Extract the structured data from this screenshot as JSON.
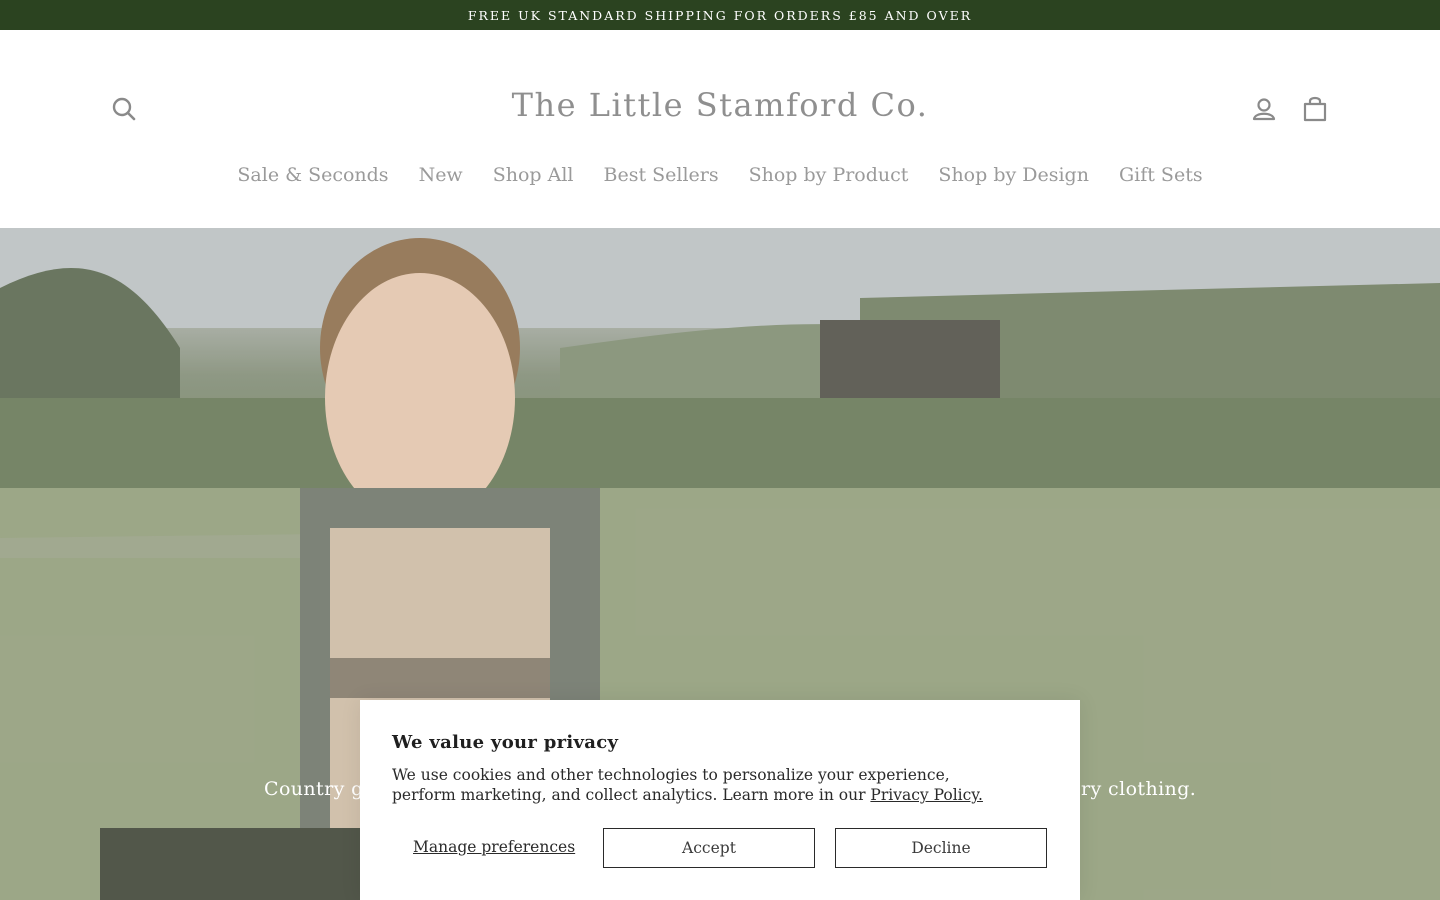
{
  "announcement": {
    "text": "FREE UK STANDARD SHIPPING FOR ORDERS £85 AND OVER"
  },
  "header": {
    "logo": "The Little Stamford Co.",
    "icons": {
      "search": "search-icon",
      "account": "user-icon",
      "cart": "shopping-bag-icon"
    }
  },
  "nav": {
    "items": [
      {
        "label": "Sale & Seconds"
      },
      {
        "label": "New"
      },
      {
        "label": "Shop All"
      },
      {
        "label": "Best Sellers"
      },
      {
        "label": "Shop by Product"
      },
      {
        "label": "Shop by Design"
      },
      {
        "label": "Gift Sets"
      }
    ]
  },
  "hero": {
    "caption_left": "Country gi",
    "caption_right": "ry clothing."
  },
  "cookie_banner": {
    "title": "We value your privacy",
    "body": "We use cookies and other technologies to personalize your experience, perform marketing, and collect analytics. Learn more in our ",
    "privacy_link": "Privacy Policy.",
    "manage_label": "Manage preferences",
    "accept_label": "Accept",
    "decline_label": "Decline"
  },
  "colors": {
    "announcement_bg": "#2b4320",
    "logo_text": "#8f8f8f",
    "nav_text": "#9a9a9a"
  }
}
